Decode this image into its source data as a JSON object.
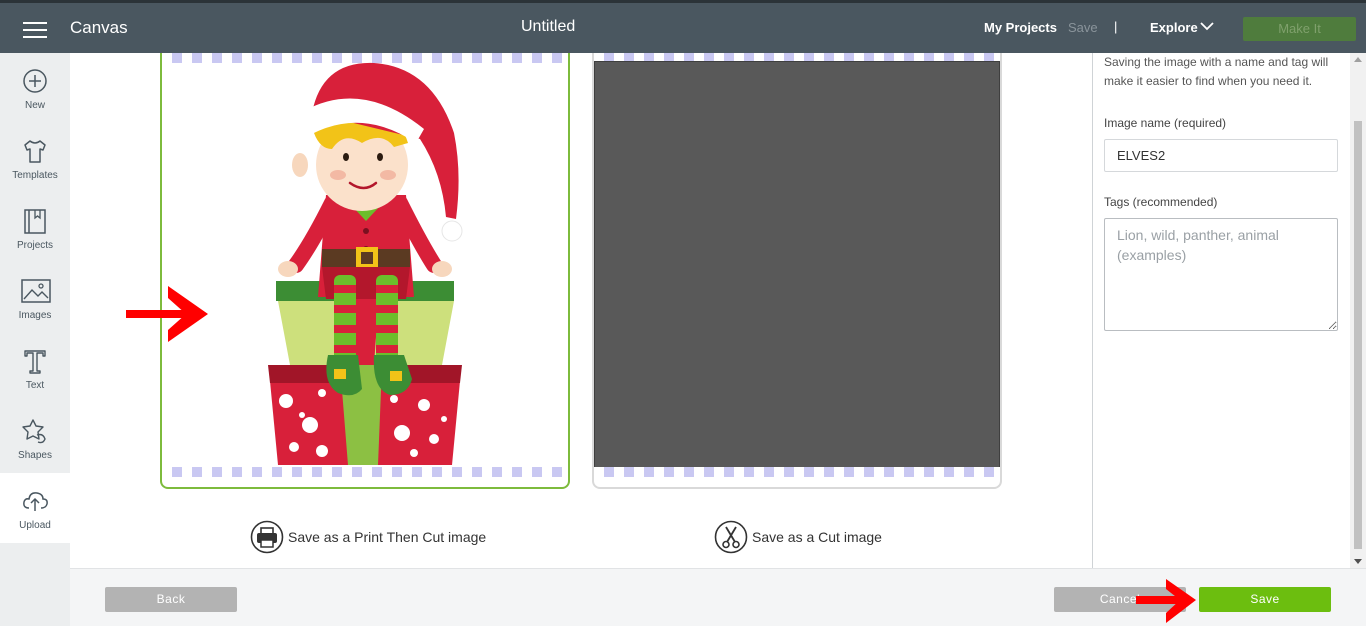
{
  "header": {
    "app_title": "Canvas",
    "doc_title": "Untitled",
    "my_projects": "My Projects",
    "save": "Save",
    "separator": "|",
    "explore": "Explore",
    "make_it": "Make It"
  },
  "sidebar": {
    "items": [
      {
        "label": "New",
        "icon": "plus-circle-icon"
      },
      {
        "label": "Templates",
        "icon": "tshirt-icon"
      },
      {
        "label": "Projects",
        "icon": "notebook-icon"
      },
      {
        "label": "Images",
        "icon": "image-icon"
      },
      {
        "label": "Text",
        "icon": "text-t-icon"
      },
      {
        "label": "Shapes",
        "icon": "shapes-icon"
      },
      {
        "label": "Upload",
        "icon": "cloud-upload-icon",
        "active": true
      }
    ]
  },
  "options": {
    "print_then_cut": "Save as a Print Then Cut image",
    "cut": "Save as a Cut image"
  },
  "panel": {
    "info": "Saving the image with a name and tag will make it easier to find when you need it.",
    "image_name_label": "Image name (required)",
    "image_name_value": "ELVES2",
    "tags_label": "Tags (recommended)",
    "tags_placeholder": "Lion, wild, panther, animal (examples)"
  },
  "footer": {
    "back": "Back",
    "cancel": "Cancel",
    "save": "Save"
  },
  "colors": {
    "topbar": "#4a5760",
    "accent_green": "#6cbe0f",
    "selected_border": "#7dbb3c",
    "annotation_arrow": "#ff0000"
  }
}
